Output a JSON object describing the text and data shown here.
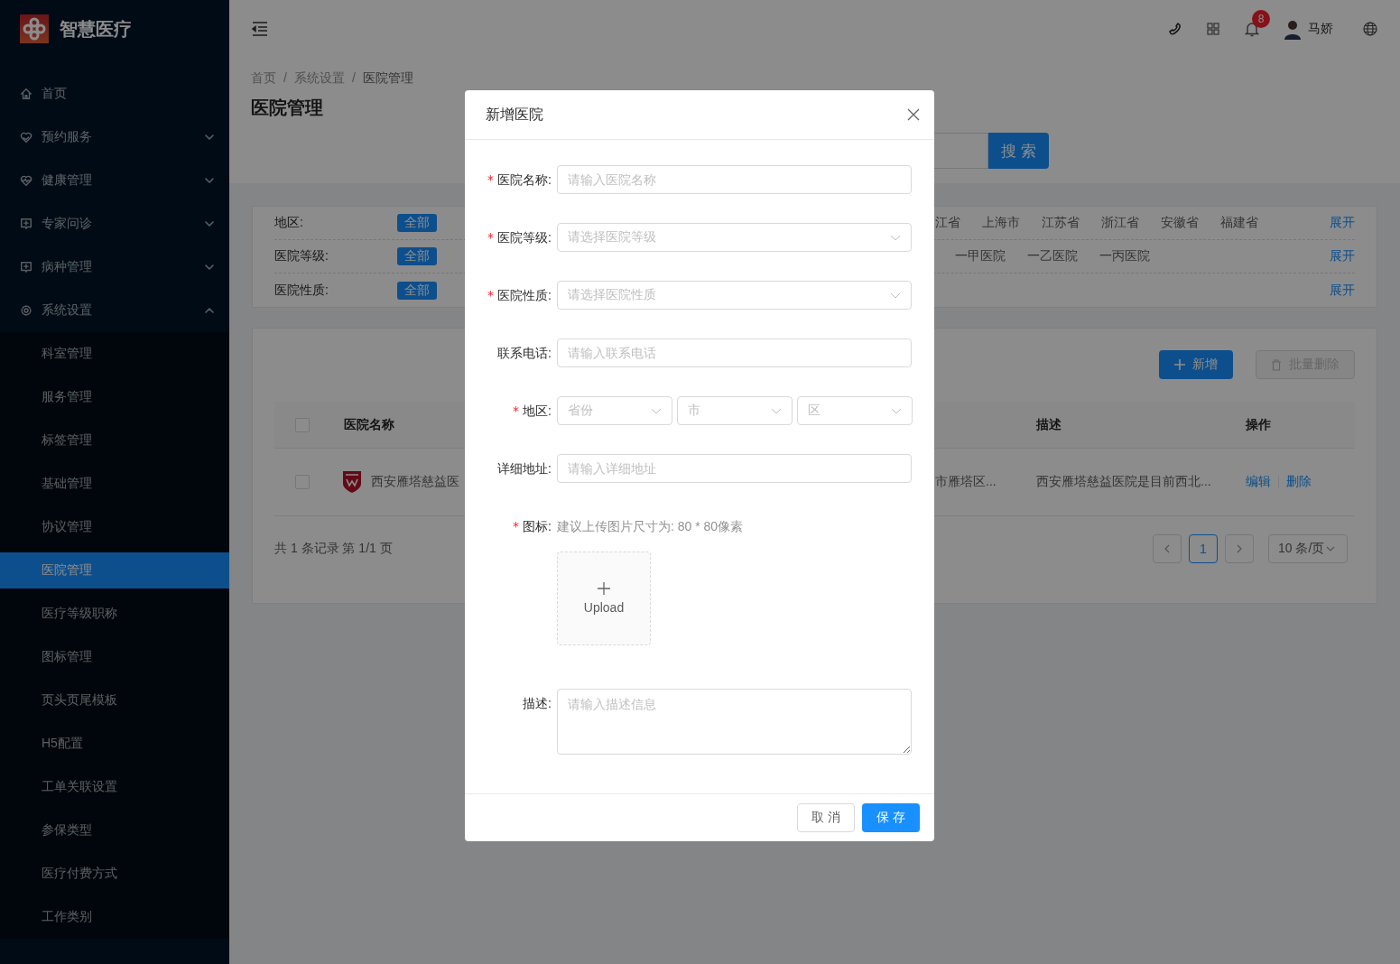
{
  "sidebar": {
    "logo_text": "智慧医疗",
    "items": [
      {
        "label": "首页"
      },
      {
        "label": "预约服务",
        "expanded": false
      },
      {
        "label": "健康管理",
        "expanded": false
      },
      {
        "label": "专家问诊",
        "expanded": false
      },
      {
        "label": "病种管理",
        "expanded": false
      },
      {
        "label": "系统设置",
        "expanded": true,
        "children": [
          {
            "label": "科室管理",
            "selected": false
          },
          {
            "label": "服务管理",
            "selected": false
          },
          {
            "label": "标签管理",
            "selected": false
          },
          {
            "label": "基础管理",
            "selected": false
          },
          {
            "label": "协议管理",
            "selected": false
          },
          {
            "label": "医院管理",
            "selected": true
          },
          {
            "label": "医疗等级职称",
            "selected": false
          },
          {
            "label": "图标管理",
            "selected": false
          },
          {
            "label": "页头页尾模板",
            "selected": false
          },
          {
            "label": "H5配置",
            "selected": false
          },
          {
            "label": "工单关联设置",
            "selected": false
          },
          {
            "label": "参保类型",
            "selected": false
          },
          {
            "label": "医疗付费方式",
            "selected": false
          },
          {
            "label": "工作类别",
            "selected": false
          }
        ]
      }
    ]
  },
  "header": {
    "notification_count": "8",
    "user_name": "马娇"
  },
  "page": {
    "breadcrumb": [
      {
        "kind": "link",
        "text": "首页"
      },
      {
        "kind": "separator",
        "text": "/"
      },
      {
        "kind": "link",
        "text": "系统设置"
      },
      {
        "kind": "separator",
        "text": "/"
      },
      {
        "kind": "current",
        "text": "医院管理"
      }
    ],
    "title": "医院管理",
    "search_button": "搜 索"
  },
  "filters": [
    {
      "label": "地区:",
      "all": "全部",
      "options": [
        "江省",
        "上海市",
        "江苏省",
        "浙江省",
        "安徽省",
        "福建省"
      ],
      "toggle": "展开"
    },
    {
      "label": "医院等级:",
      "all": "全部",
      "options": [
        "一甲医院",
        "一乙医院",
        "一丙医院"
      ],
      "toggle": "展开"
    },
    {
      "label": "医院性质:",
      "all": "全部",
      "toggle": "展开"
    }
  ],
  "table": {
    "add_button": "新增",
    "batch_delete_button": "批量删除",
    "batch_delete_disabled": true,
    "header_checked": false,
    "columns": [
      "医院名称",
      "描述",
      "操作"
    ],
    "rows": [
      {
        "checked": false,
        "name": "西安雁塔慈益医",
        "address": "市雁塔区...",
        "description": "西安雁塔慈益医院是目前西北...",
        "actions": [
          "编辑",
          "删除"
        ]
      }
    ],
    "summary": "共 1 条记录 第 1/1 页",
    "pages": [
      {
        "label": "1",
        "selected": true
      }
    ],
    "page_size": "10 条/页"
  },
  "modal": {
    "title": "新增医院",
    "fields": [
      {
        "kind": "input",
        "required_mark": "*",
        "label": "医院名称:",
        "placeholder": "请输入医院名称"
      },
      {
        "kind": "select",
        "required_mark": "*",
        "label": "医院等级:",
        "placeholder": "请选择医院等级"
      },
      {
        "kind": "select",
        "required_mark": "*",
        "label": "医院性质:",
        "placeholder": "请选择医院性质"
      },
      {
        "kind": "input",
        "label": "联系电话:",
        "placeholder": "请输入联系电话"
      },
      {
        "kind": "region",
        "required_mark": "*",
        "label": "地区:",
        "selects": [
          {
            "placeholder": "省份"
          },
          {
            "placeholder": "市"
          },
          {
            "placeholder": "区"
          }
        ]
      },
      {
        "kind": "input",
        "label": "详细地址:",
        "placeholder": "请输入详细地址"
      },
      {
        "kind": "upload",
        "required_mark": "*",
        "label": "图标:",
        "hint": "建议上传图片尺寸为: 80 * 80像素",
        "upload_label": "Upload"
      },
      {
        "kind": "textarea",
        "label": "描述:",
        "placeholder": "请输入描述信息"
      }
    ],
    "cancel_button": "取 消",
    "save_button": "保 存"
  }
}
